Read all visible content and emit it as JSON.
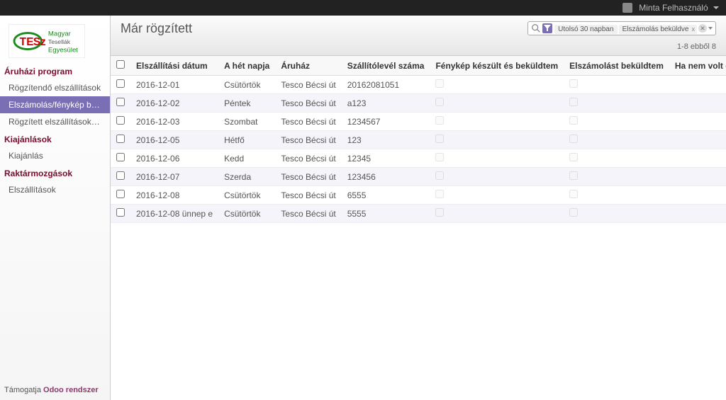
{
  "user": {
    "name": "Minta Felhasználó"
  },
  "sidebar": {
    "sections": [
      {
        "title": "Áruházi program",
        "items": [
          {
            "label": "Rögzítendő elszállítások",
            "active": false
          },
          {
            "label": "Elszámolás/fénykép bekül...",
            "active": true
          },
          {
            "label": "Rögzített elszállítások leké...",
            "active": false
          }
        ]
      },
      {
        "title": "Kiajánlások",
        "items": [
          {
            "label": "Kiajánlás",
            "active": false
          }
        ]
      },
      {
        "title": "Raktármozgások",
        "items": [
          {
            "label": "Elszállítások",
            "active": false
          }
        ]
      }
    ],
    "footer_prefix": "Támogatja ",
    "footer_brand": "Odoo rendszer"
  },
  "page": {
    "title": "Már rögzített",
    "filters": [
      {
        "label": "Utolsó 30 napban"
      },
      {
        "label": "Elszámolás beküldve"
      }
    ],
    "pager": "1-8 ebből 8",
    "columns": [
      "Elszállítási dátum",
      "A hét napja",
      "Áruház",
      "Szállítólevél száma",
      "Fénykép készült és beküldtem",
      "Elszámolást beküldtem",
      "Ha nem volt elszállítás, miért?"
    ],
    "rows": [
      {
        "date": "2016-12-01",
        "day": "Csütörtök",
        "store": "Tesco Bécsi út",
        "slip": "20162081051",
        "photo": false,
        "settle": false,
        "reason": ""
      },
      {
        "date": "2016-12-02",
        "day": "Péntek",
        "store": "Tesco Bécsi út",
        "slip": "a123",
        "photo": false,
        "settle": false,
        "reason": ""
      },
      {
        "date": "2016-12-03",
        "day": "Szombat",
        "store": "Tesco Bécsi út",
        "slip": "1234567",
        "photo": false,
        "settle": false,
        "reason": ""
      },
      {
        "date": "2016-12-05",
        "day": "Hétfő",
        "store": "Tesco Bécsi út",
        "slip": "123",
        "photo": false,
        "settle": false,
        "reason": ""
      },
      {
        "date": "2016-12-06",
        "day": "Kedd",
        "store": "Tesco Bécsi út",
        "slip": "12345",
        "photo": false,
        "settle": false,
        "reason": ""
      },
      {
        "date": "2016-12-07",
        "day": "Szerda",
        "store": "Tesco Bécsi út",
        "slip": "123456",
        "photo": false,
        "settle": false,
        "reason": ""
      },
      {
        "date": "2016-12-08",
        "day": "Csütörtök",
        "store": "Tesco Bécsi út",
        "slip": "6555",
        "photo": false,
        "settle": false,
        "reason": ""
      },
      {
        "date": "2016-12-08 ünnep e",
        "day": "Csütörtök",
        "store": "Tesco Bécsi út",
        "slip": "5555",
        "photo": false,
        "settle": false,
        "reason": ""
      }
    ]
  }
}
